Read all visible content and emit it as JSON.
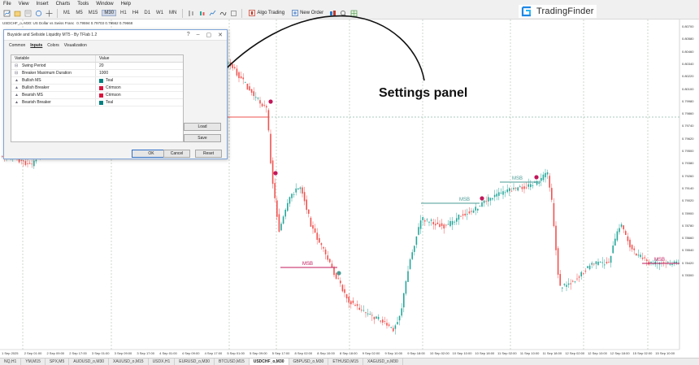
{
  "menu": [
    "File",
    "View",
    "Insert",
    "Charts",
    "Tools",
    "Window",
    "Help"
  ],
  "toolbar": {
    "timeframes": [
      "M1",
      "M5",
      "M15",
      "M30",
      "H1",
      "H4",
      "D1",
      "W1",
      "MN"
    ],
    "active_timeframe": "M30",
    "algo_trading": "Algo Trading",
    "new_order": "New Order"
  },
  "logo": {
    "text": "TradingFinder"
  },
  "chart": {
    "symbol_title": "USDCHF_o, M30: US Dollar vs Swiss Franc",
    "ohlc": "0.79594 0.79703 0.79562 0.79668",
    "price_labels": [
      "0.80700",
      "0.80580",
      "0.80460",
      "0.80340",
      "0.80220",
      "0.80100",
      "0.79980",
      "0.79860",
      "0.79740",
      "0.79620",
      "0.79500",
      "0.79380",
      "0.79260",
      "0.79140",
      "0.79020",
      "0.78900",
      "0.78780",
      "0.78660",
      "0.78540",
      "0.78420",
      "0.78300"
    ],
    "time_labels": [
      "1 Sep 2025",
      "2 Sep 01:00",
      "2 Sep 09:00",
      "2 Sep 17:00",
      "3 Sep 01:00",
      "3 Sep 09:00",
      "3 Sep 17:00",
      "4 Sep 01:00",
      "4 Sep 09:00",
      "4 Sep 17:00",
      "5 Sep 01:00",
      "5 Sep 09:00",
      "5 Sep 17:00",
      "8 Sep 02:00",
      "8 Sep 10:00",
      "8 Sep 18:00",
      "9 Sep 02:00",
      "9 Sep 10:00",
      "9 Sep 18:00",
      "10 Sep 02:00",
      "10 Sep 10:00",
      "10 Sep 18:00",
      "11 Sep 02:00",
      "11 Sep 10:00",
      "11 Sep 18:00",
      "12 Sep 02:00",
      "12 Sep 10:00",
      "12 Sep 18:00",
      "15 Sep 02:00",
      "15 Sep 10:00"
    ],
    "msb_label": "MSB",
    "colors": {
      "bull": "#26a69a",
      "bear": "#ef5350",
      "crimson": "#c2185b",
      "teal": "#4a9b95"
    }
  },
  "annotation": {
    "text": "Settings panel"
  },
  "dialog": {
    "title": "Buyside and Sellside Liquidity MT5 - By TFlab 1.2",
    "tabs": [
      "Common",
      "Inputs",
      "Colors",
      "Visualization"
    ],
    "active_tab": "Inputs",
    "columns": [
      "Variable",
      "Value"
    ],
    "rows": [
      {
        "name": "Swing Period",
        "value": "20",
        "icon": "number-icon",
        "color": ""
      },
      {
        "name": "Breaker Maximum Duration",
        "value": "1000",
        "icon": "number-icon",
        "color": ""
      },
      {
        "name": "Bullish MS",
        "value": "Teal",
        "icon": "color-icon",
        "color": "#008080"
      },
      {
        "name": "Bullish Breaker",
        "value": "Crimson",
        "icon": "color-icon",
        "color": "#DC143C"
      },
      {
        "name": "Bearish MS",
        "value": "Crimson",
        "icon": "color-icon",
        "color": "#DC143C"
      },
      {
        "name": "Bearish Breaker",
        "value": "Teal",
        "icon": "color-icon",
        "color": "#008080"
      }
    ],
    "buttons": {
      "load": "Load",
      "save": "Save",
      "ok": "OK",
      "cancel": "Cancel",
      "reset": "Reset"
    }
  },
  "tabs": {
    "items": [
      "NQ,H1",
      "YM,M15",
      "SPX,M5",
      "AUDUSD_o,M30",
      "XAUUSD_o,M15",
      "USDX,H1",
      "EURUSD_o,M30",
      "BTCUSD,M15",
      "USDCHF_o,M30",
      "GBPUSD_o,M30",
      "ETHUSD,M15",
      "XAGUSD_o,M30"
    ],
    "active": "USDCHF_o,M30"
  }
}
